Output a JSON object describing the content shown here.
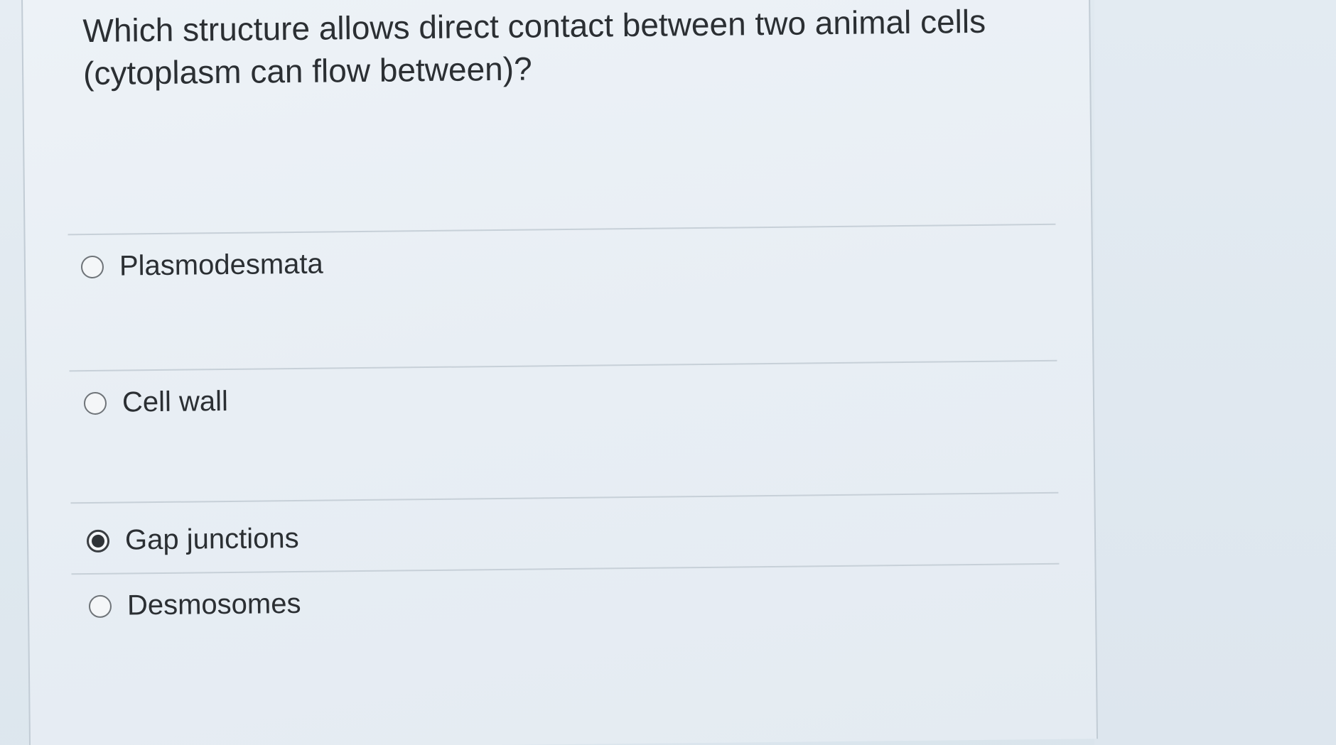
{
  "question": {
    "text": "Which structure allows direct contact between two animal cells (cytoplasm can flow between)?"
  },
  "options": [
    {
      "label": "Plasmodesmata",
      "selected": false
    },
    {
      "label": "Cell wall",
      "selected": false
    },
    {
      "label": "Gap junctions",
      "selected": true
    },
    {
      "label": "Desmosomes",
      "selected": false
    }
  ],
  "colors": {
    "text": "#2b2f33",
    "radio_border": "#6f7479",
    "selected_dot": "#2f3337",
    "divider": "#c7d0d8"
  }
}
